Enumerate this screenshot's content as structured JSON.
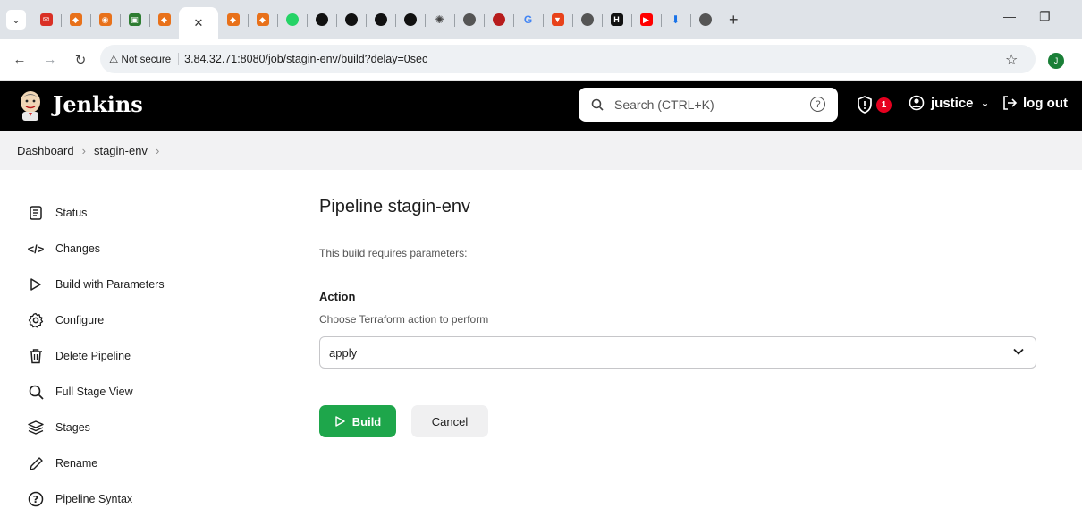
{
  "browser": {
    "tabs": [
      {
        "icon": "gmail-icon",
        "glyph": "✉",
        "color": "#d93025"
      },
      {
        "icon": "aws-icon",
        "glyph": "◆",
        "color": "#e8711a"
      },
      {
        "icon": "aws-icon",
        "glyph": "◉",
        "color": "#e8711a"
      },
      {
        "icon": "aws-icon",
        "glyph": "▣",
        "color": "#2e7d32"
      },
      {
        "icon": "aws-icon",
        "glyph": "◆",
        "color": "#e8711a"
      },
      {
        "icon": "close-icon",
        "active": true
      },
      {
        "icon": "aws-icon",
        "glyph": "◆",
        "color": "#e8711a"
      },
      {
        "icon": "aws-icon",
        "glyph": "◆",
        "color": "#e8711a"
      },
      {
        "icon": "whatsapp-icon",
        "glyph": "●",
        "color": "#25d366"
      },
      {
        "icon": "github-icon",
        "glyph": "●",
        "color": "#111111"
      },
      {
        "icon": "github-icon",
        "glyph": "●",
        "color": "#111111"
      },
      {
        "icon": "github-icon",
        "glyph": "●",
        "color": "#111111"
      },
      {
        "icon": "github-icon",
        "glyph": "●",
        "color": "#111111"
      },
      {
        "icon": "chatgpt-icon",
        "glyph": "✺",
        "color": "#444444"
      },
      {
        "icon": "globe-icon",
        "glyph": "●",
        "color": "#555555"
      },
      {
        "icon": "jenkins-icon",
        "glyph": "●",
        "color": "#b71c1c"
      },
      {
        "icon": "google-icon",
        "glyph": "G",
        "color": "#4285f4"
      },
      {
        "icon": "brave-icon",
        "glyph": "▼",
        "color": "#e8421a"
      },
      {
        "icon": "globe-icon",
        "glyph": "●",
        "color": "#555555"
      },
      {
        "icon": "hashicorp-icon",
        "glyph": "H",
        "color": "#111111"
      },
      {
        "icon": "youtube-icon",
        "glyph": "▶",
        "color": "#ff0000"
      },
      {
        "icon": "download-icon",
        "glyph": "⬇",
        "color": "#1a73e8"
      },
      {
        "icon": "globe-icon",
        "glyph": "●",
        "color": "#555555"
      }
    ],
    "new_tab": "+",
    "not_secure": "Not secure",
    "url": "3.84.32.71:8080/job/stagin-env/build?delay=0sec",
    "profile_initial": "J"
  },
  "header": {
    "title": "Jenkins",
    "search_placeholder": "Search (CTRL+K)",
    "security_count": "1",
    "user": "justice",
    "logout": "log out"
  },
  "breadcrumb": {
    "items": [
      "Dashboard",
      "stagin-env"
    ]
  },
  "sidebar": {
    "items": [
      {
        "label": "Status",
        "icon": "status-icon"
      },
      {
        "label": "Changes",
        "icon": "code-icon"
      },
      {
        "label": "Build with Parameters",
        "icon": "play-icon"
      },
      {
        "label": "Configure",
        "icon": "gear-icon"
      },
      {
        "label": "Delete Pipeline",
        "icon": "trash-icon"
      },
      {
        "label": "Full Stage View",
        "icon": "search-icon"
      },
      {
        "label": "Stages",
        "icon": "layers-icon"
      },
      {
        "label": "Rename",
        "icon": "pencil-icon"
      },
      {
        "label": "Pipeline Syntax",
        "icon": "help-icon"
      }
    ]
  },
  "main": {
    "title": "Pipeline stagin-env",
    "requires_params": "This build requires parameters:",
    "param_label": "Action",
    "param_description": "Choose Terraform action to perform",
    "param_value": "apply",
    "build_button": "Build",
    "cancel_button": "Cancel"
  },
  "colors": {
    "build_green": "#1ea64b",
    "header_bg": "#000000",
    "badge_red": "#e6001f"
  }
}
